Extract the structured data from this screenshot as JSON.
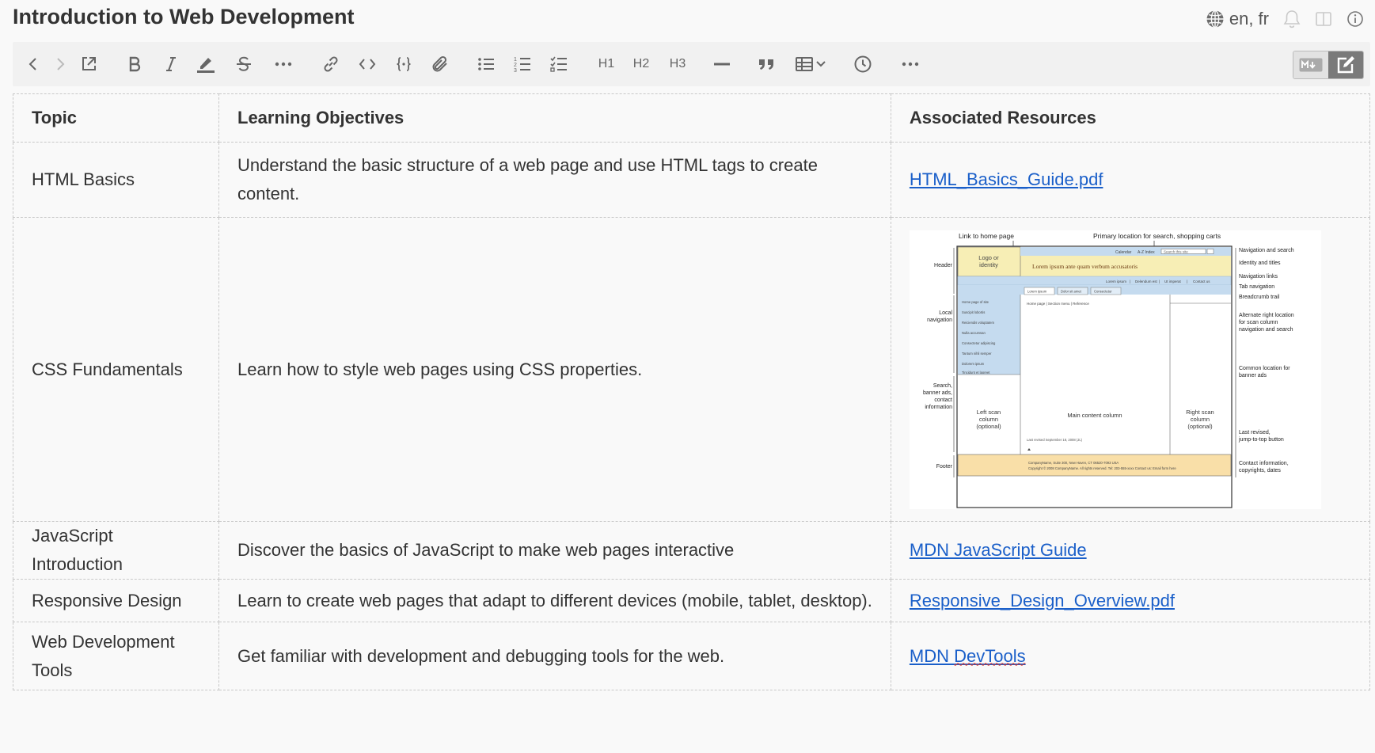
{
  "window": {
    "title": "Introduction to Web Development",
    "languages": "en, fr",
    "icons": [
      "globe-icon",
      "bell-icon",
      "split-view-icon",
      "info-icon"
    ]
  },
  "toolbar": {
    "items": [
      "back-icon",
      "forward-icon",
      "open-external-icon",
      "bold-icon",
      "italic-icon",
      "highlight-icon",
      "strikethrough-icon",
      "more-icon",
      "link-icon",
      "inline-code-icon",
      "code-block-icon",
      "attachment-icon",
      "bullet-list-icon",
      "numbered-list-icon",
      "task-list-icon",
      "h1",
      "h2",
      "h3",
      "horizontal-rule-icon",
      "quote-icon",
      "table-icon",
      "history-icon",
      "more-icon"
    ],
    "h1": "H1",
    "h2": "H2",
    "h3": "H3",
    "mode_markdown": "M↓",
    "mode_edit": "edit"
  },
  "table": {
    "headers": [
      "Topic",
      "Learning Objectives",
      "Associated Resources"
    ],
    "rows": [
      {
        "topic": "HTML Basics",
        "objective": "Understand the basic structure of a web page and use HTML tags to create content.",
        "resource": "HTML_Basics_Guide.pdf",
        "type": "link"
      },
      {
        "topic": "CSS Fundamentals",
        "objective": "Learn how to style web pages using CSS properties.",
        "resource": "",
        "type": "image"
      },
      {
        "topic": "JavaScript Introduction",
        "objective": "Discover the basics of JavaScript to make web pages interactive",
        "resource": "MDN JavaScript Guide",
        "type": "link"
      },
      {
        "topic": "Responsive Design",
        "objective": "Learn to create web pages that adapt to different devices (mobile, tablet, desktop).",
        "resource": "Responsive_Design_Overview.pdf",
        "type": "link"
      },
      {
        "topic": "Web Development Tools",
        "objective": "Get familiar with development and debugging tools for the web.",
        "resource_prefix": "MDN ",
        "resource_suffix": "DevTools",
        "type": "link"
      }
    ]
  },
  "wireframe": {
    "top_labels": [
      "Link to home page",
      "Primary location for search, shopping carts"
    ],
    "left_labels": [
      "Header",
      "Local navigation",
      "Search, banner ads, contact information",
      "Footer"
    ],
    "right_labels": [
      "Navigation and search",
      "Identity and titles",
      "Navigation links",
      "Tab navigation",
      "Breadcrumb trail",
      "Alternate right location for scan column navigation and search",
      "Common location for banner ads",
      "Last revised, jump-to-top button",
      "Contact information, copyrights, dates"
    ],
    "logo": "Logo or identity",
    "headline": "Lorem ipsum ante quam verbum accusatoris",
    "top_links": [
      "Calendar",
      "A-Z Index",
      "Search this site"
    ],
    "nav_links": [
      "Lorem ipsum",
      "Delendum est",
      "Ut imperat",
      "Contact us"
    ],
    "tabs": [
      "Lorem ipsum",
      "Dolor sit amet",
      "Consectetur"
    ],
    "breadcrumb": "Home page  |  Section menu  |  Reference",
    "sidebar_links": [
      "Home page of site",
      "Suscipit lobortis",
      "Reiciendis voluptatem",
      "Nulla accumsan",
      "Consectetur adipiscing",
      "Tantum nihil semper",
      "Dolorem ipsum",
      "Tincidunt et laoreet"
    ],
    "left_col": "Left scan column (optional)",
    "main_col": "Main content column",
    "right_col": "Right scan column (optional)",
    "last_revised": "Last revised September 18, 2008 (JL)",
    "footer_line1": "CompanyName, Suite 300, New Haven, CT 06520-7093  USA",
    "footer_line2": "Copyright © 2008 CompanyName. All rights reserved.   Tel: 203-555-xxxx      Contact us: Email form here"
  },
  "colors": {
    "link": "#1a5fc9",
    "toolbar_bg": "#f1f1f1",
    "page_bg": "#f9f9f9",
    "wf_header": "#f7eeb5",
    "wf_nav": "#c5dbef",
    "wf_footer": "#f9dfa8"
  }
}
